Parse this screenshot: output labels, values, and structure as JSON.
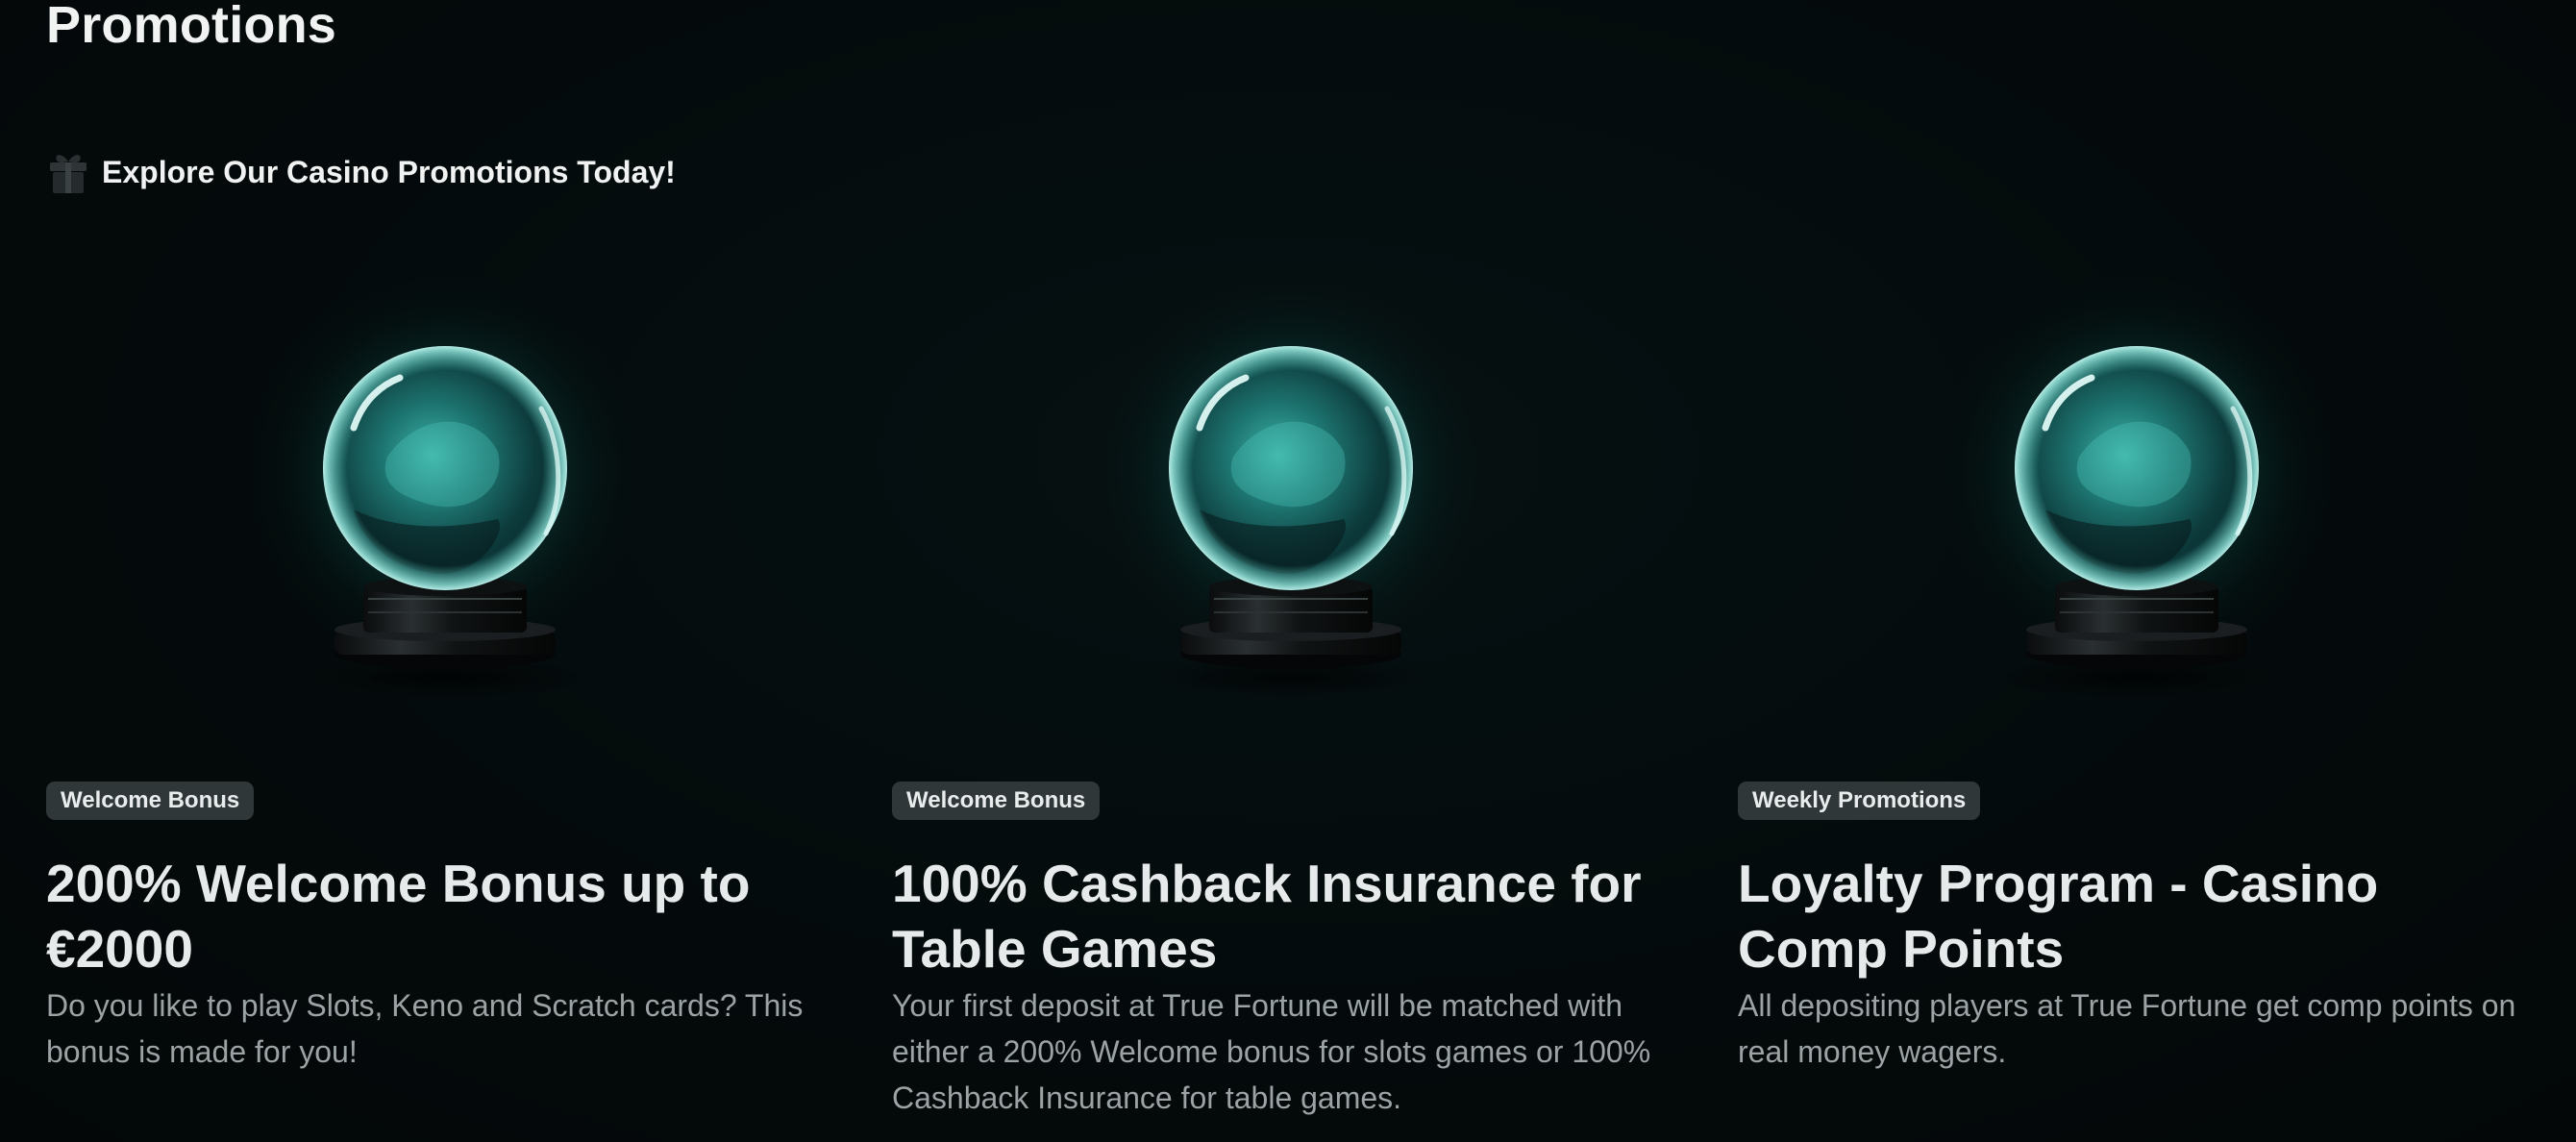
{
  "page": {
    "title": "Promotions",
    "subheading": "Explore Our Casino Promotions Today!",
    "icon": "gift-icon"
  },
  "colors": {
    "background": "#040a0b",
    "tag_background": "#2f3738",
    "accent_glow": "#19c9b3",
    "title_text": "#e7eaea",
    "description_text": "#9ca3a4"
  },
  "promotions": [
    {
      "tag": "Welcome Bonus",
      "title": "200% Welcome Bonus up to €2000",
      "description": "Do you like to play Slots, Keno and Scratch cards? This bonus is made for you!",
      "image": "crystal-ball-image"
    },
    {
      "tag": "Welcome Bonus",
      "title": "100% Cashback Insurance for Table Games",
      "description": "Your first deposit at True Fortune will be matched with either a 200% Welcome bonus for slots games or 100% Cashback Insurance for table games.",
      "image": "crystal-ball-image"
    },
    {
      "tag": "Weekly Promotions",
      "title": "Loyalty Program - Casino Comp Points",
      "description": "All depositing players at True Fortune get comp points on real money wagers.",
      "image": "crystal-ball-image"
    }
  ]
}
